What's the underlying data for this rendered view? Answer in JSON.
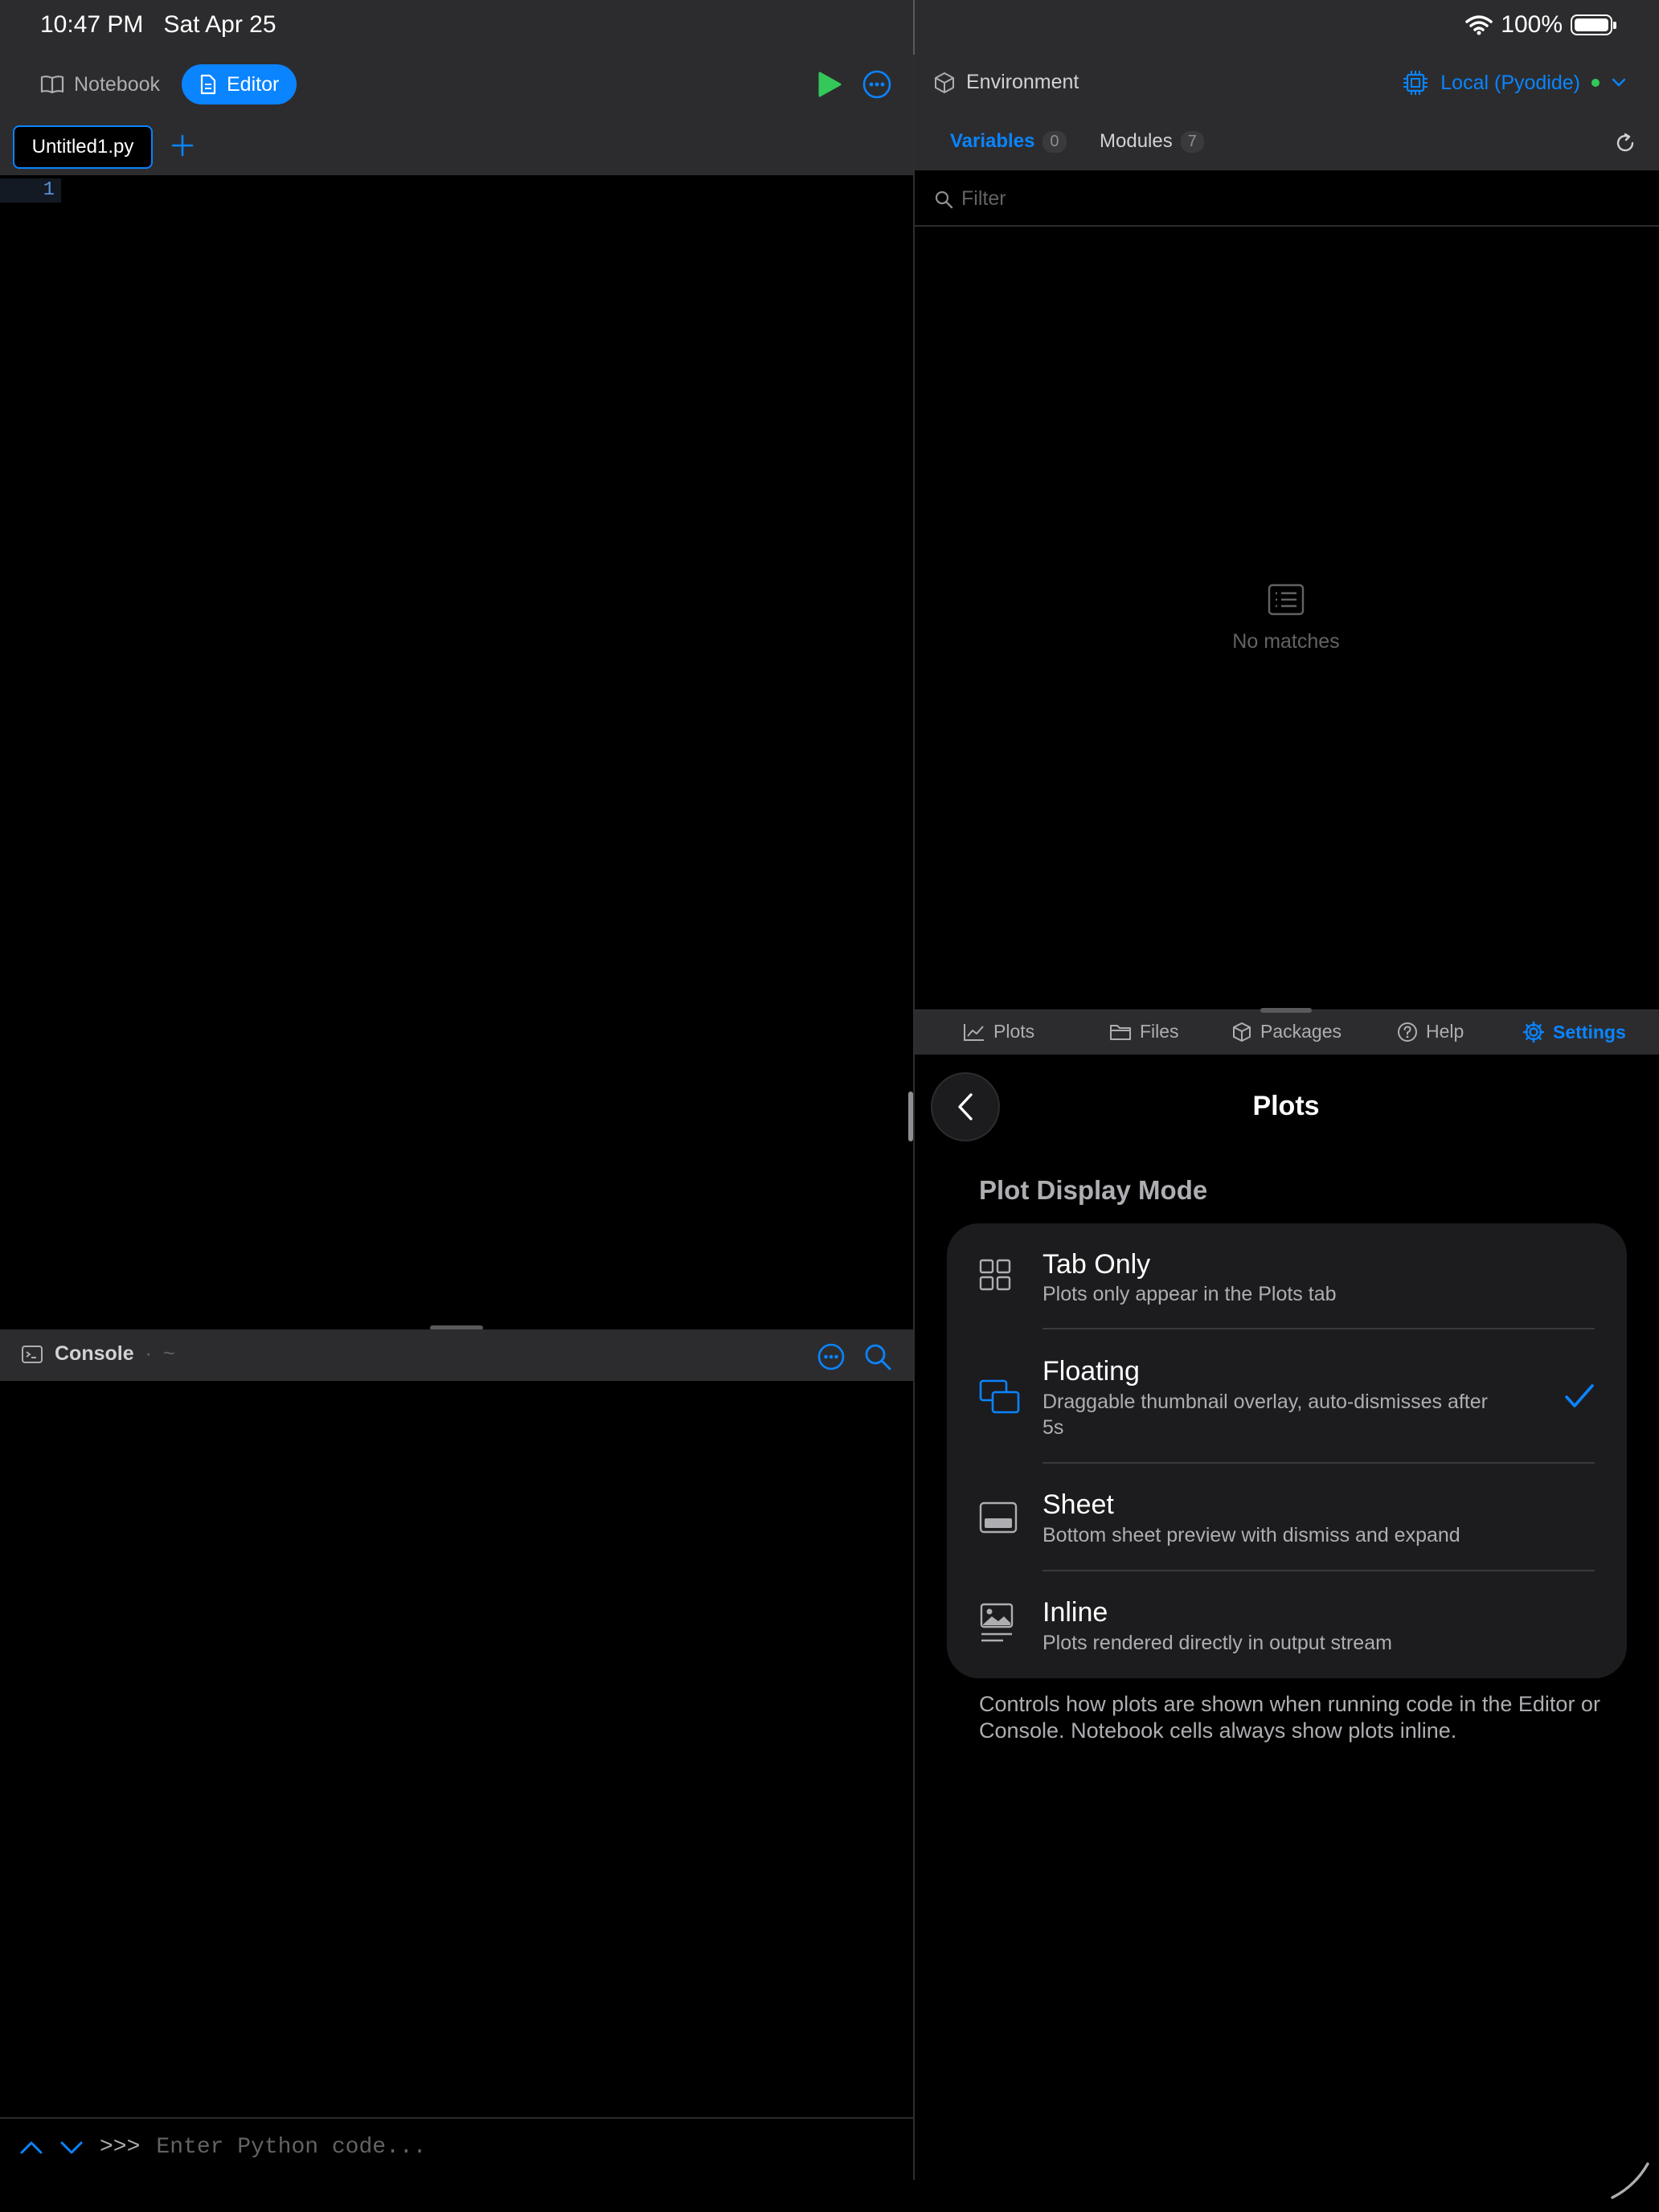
{
  "status_bar": {
    "time": "10:47 PM",
    "date": "Sat Apr 25",
    "battery": "100%"
  },
  "left_header": {
    "notebook_label": "Notebook",
    "editor_label": "Editor"
  },
  "editor": {
    "tab_label": "Untitled1.py",
    "line_number": "1"
  },
  "console": {
    "title": "Console",
    "sep": "·",
    "path": "~",
    "prompt": ">>>",
    "placeholder": "Enter Python code..."
  },
  "environment": {
    "title": "Environment",
    "kernel": "Local (Pyodide)",
    "tabs": [
      {
        "label": "Variables",
        "count": "0"
      },
      {
        "label": "Modules",
        "count": "7"
      }
    ],
    "filter_placeholder": "Filter",
    "empty_text": "No matches"
  },
  "bottom_tabs": [
    {
      "label": "Plots",
      "icon": "chart-icon"
    },
    {
      "label": "Files",
      "icon": "folder-icon"
    },
    {
      "label": "Packages",
      "icon": "cube-icon"
    },
    {
      "label": "Help",
      "icon": "help-icon"
    },
    {
      "label": "Settings",
      "icon": "gear-icon",
      "active": true
    }
  ],
  "settings": {
    "title": "Plots",
    "section_header": "Plot Display Mode",
    "options": [
      {
        "label": "Tab Only",
        "description": "Plots only appear in the Plots tab",
        "icon": "grid-icon",
        "selected": false
      },
      {
        "label": "Floating",
        "description": "Draggable thumbnail overlay, auto-dismisses after 5s",
        "icon": "floating-windows-icon",
        "selected": true
      },
      {
        "label": "Sheet",
        "description": "Bottom sheet preview with dismiss and expand",
        "icon": "sheet-icon",
        "selected": false
      },
      {
        "label": "Inline",
        "description": "Plots rendered directly in output stream",
        "icon": "inline-image-icon",
        "selected": false
      }
    ],
    "footer": "Controls how plots are shown when running code in the Editor or Console. Notebook cells always show plots inline."
  },
  "colors": {
    "accent": "#0a84ff",
    "run": "#34c759",
    "panel": "#2c2c2e",
    "card": "#1c1c1e"
  }
}
